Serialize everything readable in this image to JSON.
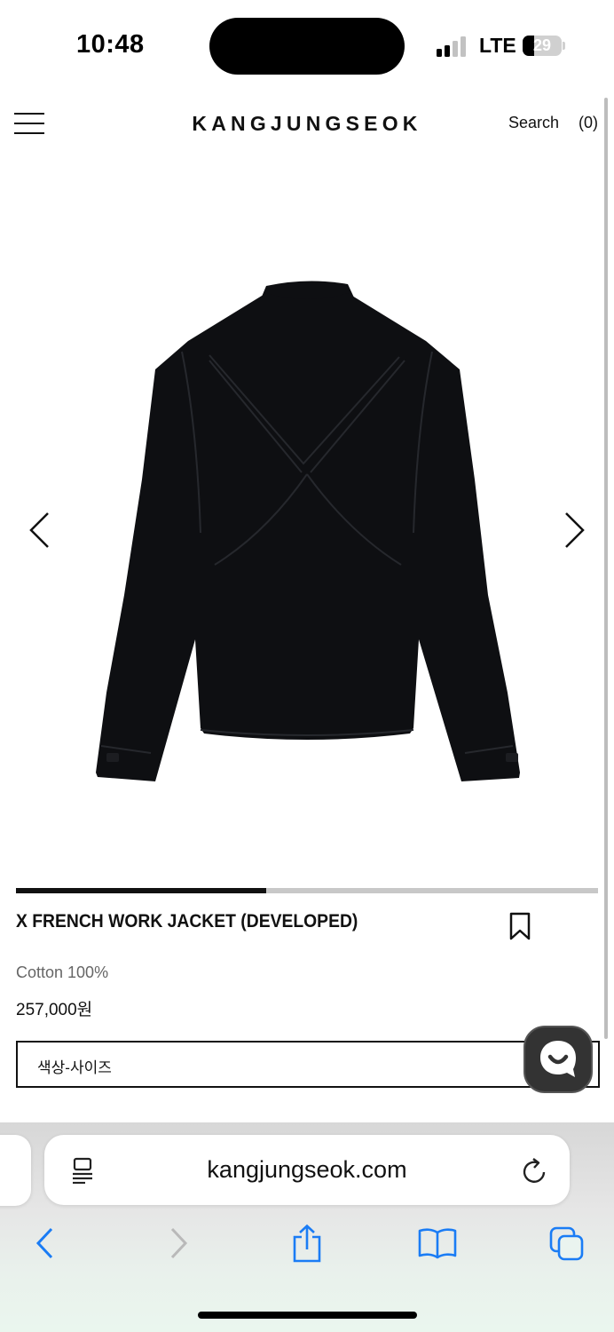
{
  "status_bar": {
    "time": "10:48",
    "network": "LTE",
    "battery": "29",
    "battery_level": 0.29
  },
  "header": {
    "brand": "KANGJUNGSEOK",
    "search_label": "Search",
    "cart_count": "(0)"
  },
  "gallery": {
    "image_progress": 0.43
  },
  "product": {
    "title": "X FRENCH WORK JACKET (DEVELOPED)",
    "material": "Cotton 100%",
    "price": "257,000원",
    "option_label": "색상-사이즈"
  },
  "browser": {
    "url": "kangjungseok.com"
  },
  "colors": {
    "accent": "#1a7cf5",
    "text": "#111111",
    "jacket": "#0e0f12"
  },
  "icons": {
    "menu": "hamburger-icon",
    "prev": "chevron-left-icon",
    "next": "chevron-right-icon",
    "bookmark": "bookmark-icon",
    "chat": "chat-icon",
    "reader": "reader-mode-icon",
    "reload": "reload-icon",
    "back": "back-icon",
    "forward": "forward-icon",
    "share": "share-icon",
    "bookmarks": "book-icon",
    "tabs": "tabs-icon"
  }
}
